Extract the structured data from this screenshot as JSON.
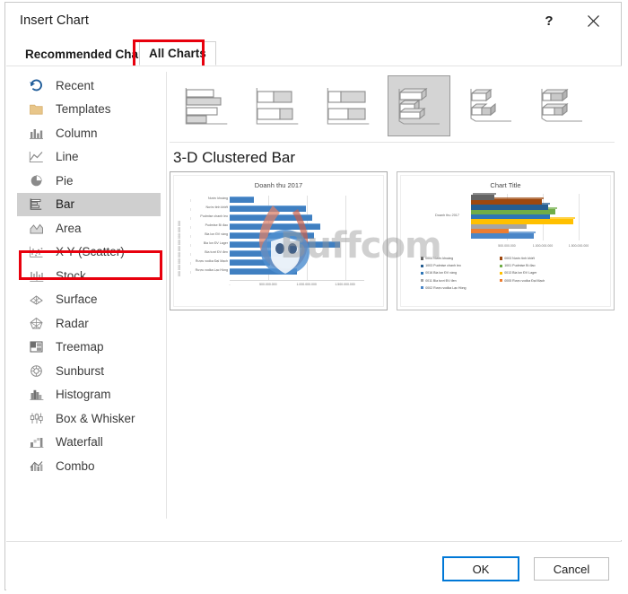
{
  "dialog": {
    "title": "Insert Chart",
    "help_icon": "?",
    "close_icon": "close-icon"
  },
  "tabs": [
    {
      "id": "recommended",
      "label": "Recommended Charts",
      "selected": false
    },
    {
      "id": "all",
      "label": "All Charts",
      "selected": true,
      "highlighted": true
    }
  ],
  "sidebar": {
    "items": [
      {
        "label": "Recent",
        "icon": "recent-icon",
        "selected": false
      },
      {
        "label": "Templates",
        "icon": "templates-folder-icon",
        "selected": false
      },
      {
        "label": "Column",
        "icon": "column-chart-icon",
        "selected": false
      },
      {
        "label": "Line",
        "icon": "line-chart-icon",
        "selected": false
      },
      {
        "label": "Pie",
        "icon": "pie-chart-icon",
        "selected": false
      },
      {
        "label": "Bar",
        "icon": "bar-chart-icon",
        "selected": true,
        "highlighted": true
      },
      {
        "label": "Area",
        "icon": "area-chart-icon",
        "selected": false
      },
      {
        "label": "X Y (Scatter)",
        "icon": "scatter-chart-icon",
        "selected": false
      },
      {
        "label": "Stock",
        "icon": "stock-chart-icon",
        "selected": false
      },
      {
        "label": "Surface",
        "icon": "surface-chart-icon",
        "selected": false
      },
      {
        "label": "Radar",
        "icon": "radar-chart-icon",
        "selected": false
      },
      {
        "label": "Treemap",
        "icon": "treemap-chart-icon",
        "selected": false
      },
      {
        "label": "Sunburst",
        "icon": "sunburst-chart-icon",
        "selected": false
      },
      {
        "label": "Histogram",
        "icon": "histogram-chart-icon",
        "selected": false
      },
      {
        "label": "Box & Whisker",
        "icon": "boxwhisker-chart-icon",
        "selected": false
      },
      {
        "label": "Waterfall",
        "icon": "waterfall-chart-icon",
        "selected": false
      },
      {
        "label": "Combo",
        "icon": "combo-chart-icon",
        "selected": false
      }
    ]
  },
  "chart_subtypes": [
    {
      "name": "Clustered Bar",
      "selected": false
    },
    {
      "name": "Stacked Bar",
      "selected": false
    },
    {
      "name": "100% Stacked Bar",
      "selected": false
    },
    {
      "name": "3-D Clustered Bar",
      "selected": true
    },
    {
      "name": "3-D Stacked Bar",
      "selected": false
    },
    {
      "name": "3-D 100% Stacked Bar",
      "selected": false
    }
  ],
  "section": {
    "title": "3-D Clustered Bar"
  },
  "watermark": {
    "text": "Buffcom"
  },
  "footer": {
    "ok_label": "OK",
    "cancel_label": "Cancel"
  },
  "chart_data": [
    {
      "id": "preview-left",
      "type": "bar",
      "title": "Doanh thu 2017",
      "xlabel": "",
      "ylabel": "",
      "orientation": "horizontal",
      "categories": [
        "Nước khoáng",
        "Nước tinh khiết",
        "Pudmise chanh leo",
        "Pudmise Bí đao",
        "Bia lon ĐV vàng",
        "Bia lon ĐV Lager",
        "Bia tươi ĐV đen",
        "Rượu vodka Đại Mạch",
        "Rượu vodka Lạc Hồng"
      ],
      "values": [
        320000000,
        990000000,
        1070000000,
        1180000000,
        1100000000,
        1430000000,
        770000000,
        530000000,
        880000000
      ],
      "xticks": [
        "-",
        "500.000.000",
        "1.000.000.000",
        "1.500.000.000"
      ],
      "xlim": [
        0,
        1750000000
      ],
      "series_color": "#3f7fc1",
      "grid": true,
      "legend": "none"
    },
    {
      "id": "preview-right",
      "type": "bar",
      "title": "Chart Title",
      "orientation": "horizontal",
      "categories": [
        "Doanh thu 2017"
      ],
      "xticks": [
        "500.000.000",
        "1.000.000.000",
        "1.500.000.000"
      ],
      "xlim": [
        0,
        1750000000
      ],
      "grid": true,
      "legend": "bottom",
      "series": [
        {
          "name": "0002 Rượu vodka Lạc Hồng",
          "color": "#4a86c8",
          "values": [
            880000000
          ]
        },
        {
          "name": "0005 Rượu vodka Đại Mạch",
          "color": "#ed7d31",
          "values": [
            530000000
          ]
        },
        {
          "name": "0011 Bia tươi ĐV đen",
          "color": "#a5a5a5",
          "values": [
            770000000
          ]
        },
        {
          "name": "0013 Bia lon ĐV Lager",
          "color": "#ffc000",
          "values": [
            1430000000
          ]
        },
        {
          "name": "0016 Bia lon ĐV vàng",
          "color": "#2e75b6",
          "values": [
            1100000000
          ]
        },
        {
          "name": "1001 Pudmise Bí đao",
          "color": "#70ad47",
          "values": [
            1180000000
          ]
        },
        {
          "name": "1003 Pudmise chanh leo",
          "color": "#255e91",
          "values": [
            1070000000
          ]
        },
        {
          "name": "0003 Nước tinh khiết",
          "color": "#9e480e",
          "values": [
            990000000
          ]
        },
        {
          "name": "0004 Nước khoáng",
          "color": "#636363",
          "values": [
            320000000
          ]
        }
      ],
      "legend_entries": [
        {
          "label": "0004 Nước khoáng",
          "color": "#636363"
        },
        {
          "label": "0003 Nước tinh khiết",
          "color": "#9e480e"
        },
        {
          "label": "1003 Pudmise chanh leo",
          "color": "#255e91"
        },
        {
          "label": "1001 Pudmise Bí đao",
          "color": "#70ad47"
        },
        {
          "label": "0016 Bia lon ĐV vàng",
          "color": "#2e75b6"
        },
        {
          "label": "0013 Bia lon ĐV Lager",
          "color": "#ffc000"
        },
        {
          "label": "0011 Bia tươi ĐV đen",
          "color": "#a5a5a5"
        },
        {
          "label": "0005 Rượu vodka Đại Mạch",
          "color": "#ed7d31"
        },
        {
          "label": "0002 Rượu vodka Lạc Hồng",
          "color": "#4a86c8"
        }
      ]
    }
  ],
  "colors": {
    "highlight": "#e8000d",
    "accent": "#0078d7",
    "selection": "#cfcfcf"
  }
}
